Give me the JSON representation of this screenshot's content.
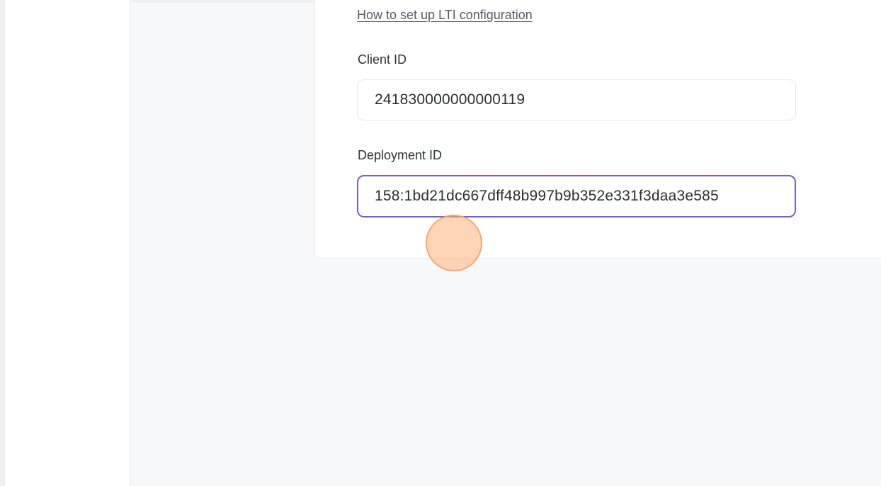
{
  "lti_config": {
    "help_link_text": "How to set up LTI configuration",
    "client_id": {
      "label": "Client ID",
      "value": "241830000000000119"
    },
    "deployment_id": {
      "label": "Deployment ID",
      "value": "158:1bd21dc667dff48b997b9b352e331f3daa3e585"
    }
  },
  "colors": {
    "focus_border": "#7b5bd6",
    "click_marker": "#f8a05f",
    "page_background": "#f7f8fa"
  }
}
